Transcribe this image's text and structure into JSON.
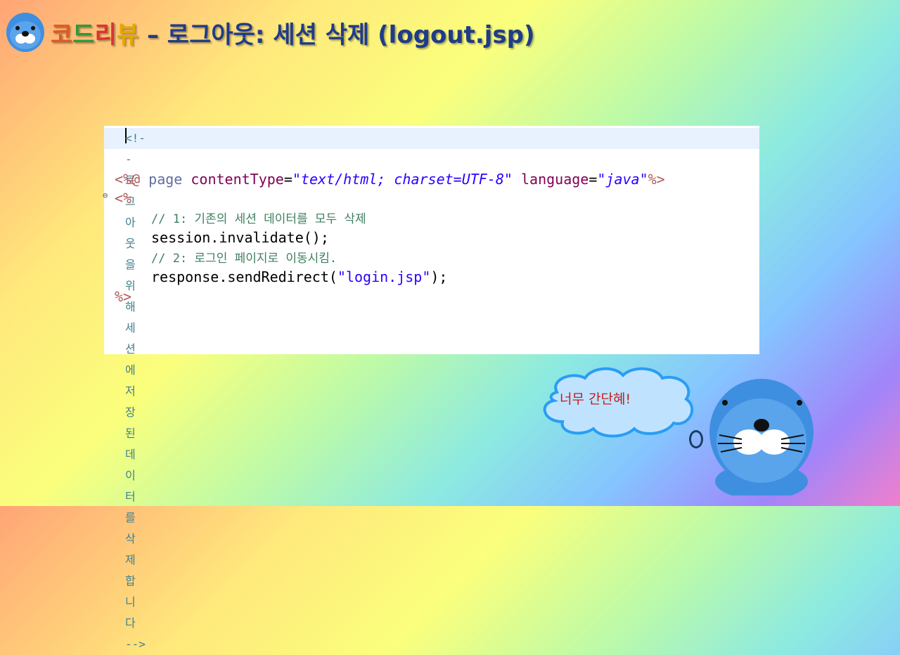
{
  "slide": {
    "title_parts": {
      "p1": "코",
      "p2": "드",
      "p3": "리",
      "p4": "뷰",
      "rest": " – 로그아웃: 세션 삭제 (logout.jsp)"
    }
  },
  "code": {
    "comment_line": "<!-- 로그아웃을 위해 세션에 저장된 데이터를 삭제합니다 -->",
    "line_directive": {
      "open": "<%@",
      "page": " page ",
      "attr1": "contentType",
      "eq1": "=",
      "val1": "\"text/html; charset=UTF-8\"",
      "attr2": " language",
      "eq2": "=",
      "val2": "\"java\"",
      "close": "%>"
    },
    "scriptlet_open": "<%",
    "comment1": "// 1: 기존의 세션 데이터를 모두 삭제",
    "stmt1": "session.invalidate();",
    "comment2": "// 2: 로그인 페이지로 이동시킴.",
    "stmt2_pre": "response.sendRedirect(",
    "stmt2_str": "\"login.jsp\"",
    "stmt2_post": ");",
    "scriptlet_close": "%>"
  },
  "speech": {
    "text": "너무 간단혜!",
    "bubble_o": "o"
  },
  "colors": {
    "title_main": "#1f3b8a",
    "cloud_stroke": "#2a9df4",
    "cloud_fill": "#bfe3ff",
    "speech_text": "#c0201d",
    "mascot_body": "#3f8fe0"
  },
  "icons": [
    "otter-mascot-icon",
    "cloud-icon",
    "fold-collapse-icon"
  ]
}
